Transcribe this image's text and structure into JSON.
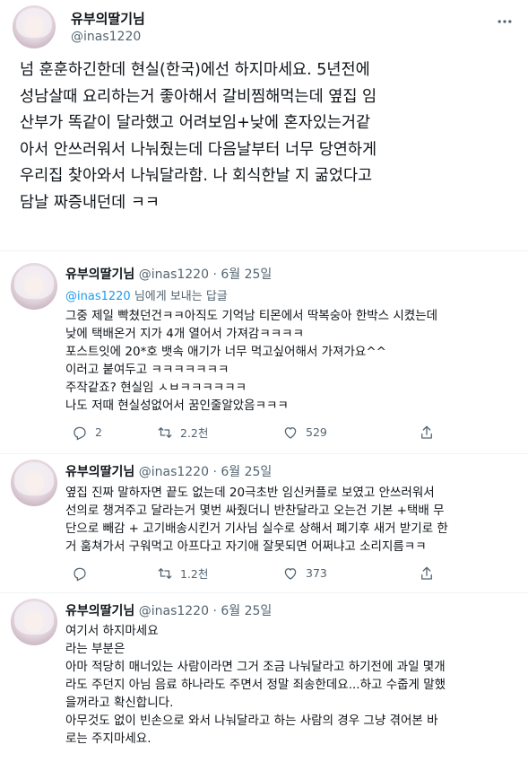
{
  "main_tweet": {
    "display_name": "유부의딸기님",
    "handle": "@inas1220",
    "text": "넘 훈훈하긴한데 현실(한국)에선 하지마세요. 5년전에\n성남살때 요리하는거 좋아해서 갈비찜해먹는데 옆집 임\n산부가 똑같이 달라했고 어려보임+낮에 혼자있는거같\n아서 안쓰러워서 나눠줬는데 다음날부터 너무 당연하게\n우리집 찾아와서  나눠달라함. 나 회식한날 지 굶었다고\n담날 짜증내던데 ㅋㅋ"
  },
  "replies": [
    {
      "display_name": "유부의딸기님",
      "handle": "@inas1220",
      "separator": "·",
      "date": "6월 25일",
      "reply_to_mention": "@inas1220",
      "reply_to_suffix": " 님에게 보내는 답글",
      "text": "그중 제일 빡쳤던건ㅋㅋ아직도 기억남 티몬에서 딱복숭아 한박스 시켰는데\n낮에 택배온거 지가 4개 열어서 가져감ㅋㅋㅋㅋ\n포스트잇에 20*호 뱃속 애기가 너무 먹고싶어해서 가져가요^^\n이러고 붙여두고 ㅋㅋㅋㅋㅋㅋㅋ\n주작같죠? 현실임 ㅅㅂㅋㅋㅋㅋㅋㅋ\n나도 저때 현실성없어서 꿈인줄알았음ㅋㅋㅋ",
      "replies_count": "2",
      "retweets_count": "2.2천",
      "likes_count": "529"
    },
    {
      "display_name": "유부의딸기님",
      "handle": "@inas1220",
      "separator": "·",
      "date": "6월 25일",
      "text": "옆집 진짜 말하자면 끝도 없는데  20극초반 임신커플로 보였고 안쓰러워서\n선의로 챙겨주고 달라는거 몇번 싸줬더니 반찬달라고 오는건 기본 +택배 무\n단으로 빼감 + 고기배송시킨거 기사님 실수로  상해서 폐기후 새거 받기로 한\n거 훔쳐가서 구워먹고 아프다고 자기애 잘못되면 어쩌냐고 소리지름ㅋㅋ",
      "retweets_count": "1.2천",
      "likes_count": "373"
    },
    {
      "display_name": "유부의딸기님",
      "handle": "@inas1220",
      "separator": "·",
      "date": "6월 25일",
      "text": "여기서 하지마세요\n라는 부분은\n아마 적당히 매너있는 사람이라면 그거 조금 나눠달라고 하기전에 과일 몇개\n라도 주던지 아님 음료 하나라도 주면서 정말 죄송한데요...하고 수줍게 말했\n을꺼라고 확신합니다.\n아무것도 없이 빈손으로 와서 나눠달라고 하는 사람의 경우 그냥 겪어본 바\n로는 주지마세요."
    }
  ],
  "icons": {
    "more": "more-horizontal-icon",
    "reply": "reply-icon",
    "retweet": "retweet-icon",
    "like": "heart-icon",
    "share": "share-icon"
  },
  "colors": {
    "text": "#0f1419",
    "secondary": "#536471",
    "link": "#1d9bf0",
    "divider": "#eff3f4"
  }
}
